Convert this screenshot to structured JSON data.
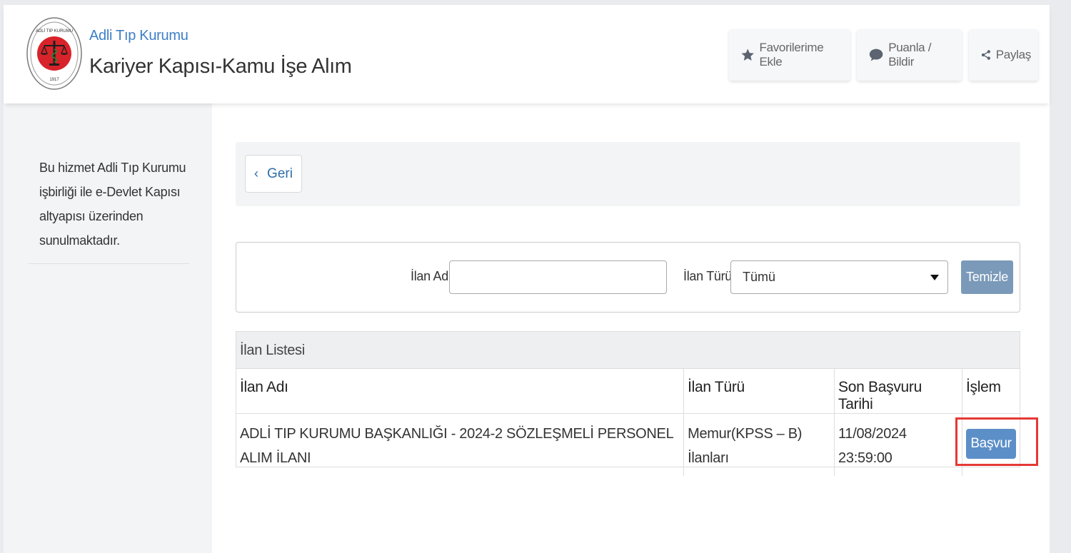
{
  "header": {
    "institution": "Adli Tıp Kurumu",
    "service_title": "Kariyer Kapısı-Kamu İşe Alım",
    "logo_icon": "adli-tip-kurumu-seal",
    "logo_text_top": "ADLİ TIP KURUMU",
    "logo_year": "1917",
    "buttons": {
      "favorite": "Favorilerime Ekle",
      "rate": "Puanla / Bildir",
      "share": "Paylaş"
    }
  },
  "sidebar": {
    "description": "Bu hizmet Adli Tıp Kurumu işbirliği ile e-Devlet Kapısı altyapısı üzerinden sunulmaktadır."
  },
  "nav": {
    "back_label": "Geri"
  },
  "filters": {
    "name_label": "İlan Adı",
    "name_value": "",
    "type_label": "İlan Türü",
    "type_selected": "Tümü",
    "clear_label": "Temizle"
  },
  "table": {
    "title": "İlan Listesi",
    "headers": [
      "İlan Adı",
      "İlan Türü",
      "Son Başvuru Tarihi",
      "İşlem"
    ],
    "rows": [
      {
        "name": "ADLİ TIP KURUMU BAŞKANLIĞI - 2024-2 SÖZLEŞMELİ PERSONEL ALIM İLANI",
        "type": "Memur(KPSS – B) İlanları",
        "deadline": "11/08/2024 23:59:00",
        "action": "Başvur"
      }
    ]
  },
  "colors": {
    "accent_blue": "#3d7fc6",
    "apply_button": "#5c8fc8",
    "clear_button": "#7b9ab9",
    "highlight_red": "#e53935"
  }
}
